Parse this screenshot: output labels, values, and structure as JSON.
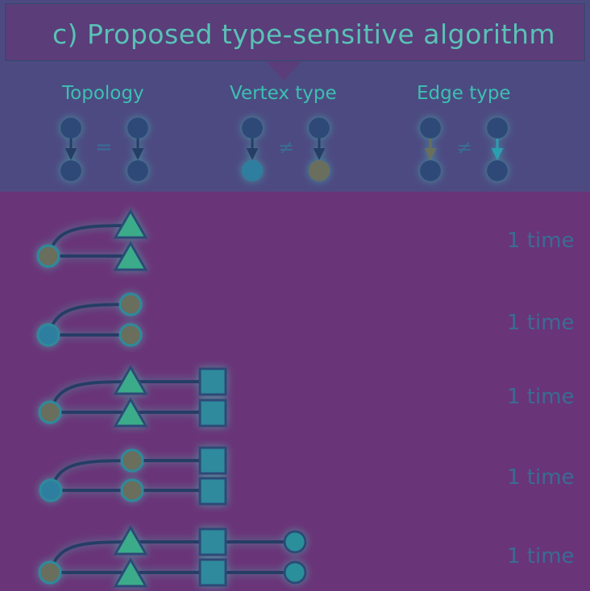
{
  "title": "c)  Proposed type-sensitive algorithm",
  "columns": [
    {
      "label": "Topology",
      "relation": "="
    },
    {
      "label": "Vertex type",
      "relation": "≠"
    },
    {
      "label": "Edge type",
      "relation": "≠"
    }
  ],
  "colors": {
    "background": "#6a3478",
    "header_band": "#4d4a82",
    "node_dark": "#2e4a78",
    "node_blue": "#2f7ea0",
    "node_olive": "#6a6e5c",
    "node_teal": "#2a8f9a",
    "triangle": "#3aab8a",
    "square": "#2e8a9c",
    "edge_line": "#263d66",
    "glow": "#3fd0b4"
  },
  "motifs": [
    {
      "count_label": "1 time",
      "shapes": [
        "circle-olive",
        "triangle",
        "triangle"
      ]
    },
    {
      "count_label": "1 time",
      "shapes": [
        "circle-blue",
        "circle-olive",
        "circle-olive"
      ]
    },
    {
      "count_label": "1 time",
      "shapes": [
        "circle-olive",
        "triangle",
        "triangle",
        "square",
        "square"
      ]
    },
    {
      "count_label": "1 time",
      "shapes": [
        "circle-blue",
        "circle-olive",
        "circle-olive",
        "square",
        "square"
      ]
    },
    {
      "count_label": "1 time",
      "shapes": [
        "circle-olive",
        "triangle",
        "triangle",
        "square",
        "square",
        "circle-teal",
        "circle-teal"
      ]
    }
  ]
}
